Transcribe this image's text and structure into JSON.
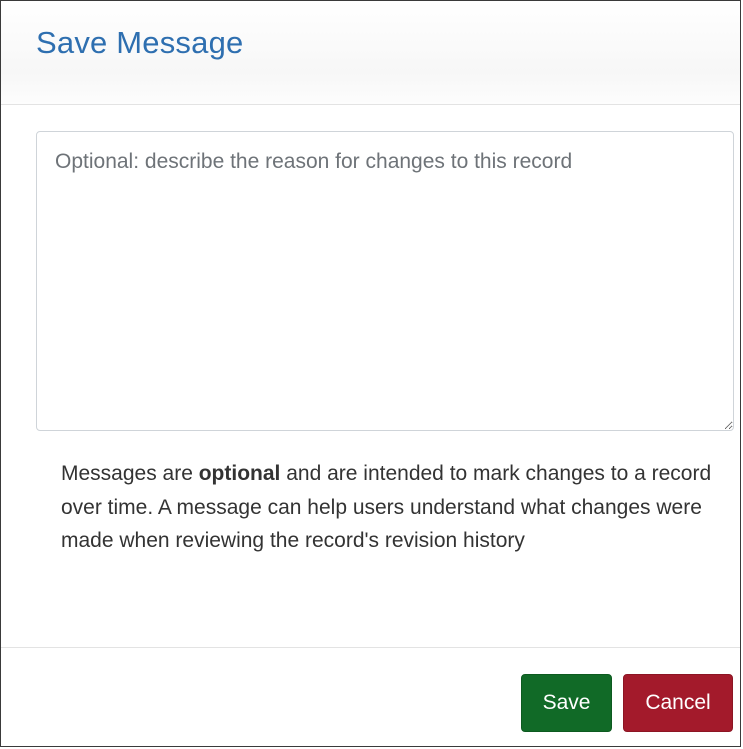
{
  "dialog": {
    "title": "Save Message",
    "message_field": {
      "value": "",
      "placeholder": "Optional: describe the reason for changes to this record"
    },
    "help_text": {
      "before_bold": "Messages are ",
      "bold": "optional",
      "after_bold": " and are intended to mark changes to a record over time. A message can help users understand what changes were made when reviewing the record's revision history"
    },
    "buttons": {
      "save_label": "Save",
      "cancel_label": "Cancel"
    }
  },
  "colors": {
    "title": "#2e6fb0",
    "save_button": "#116a27",
    "cancel_button": "#a31a2b"
  }
}
